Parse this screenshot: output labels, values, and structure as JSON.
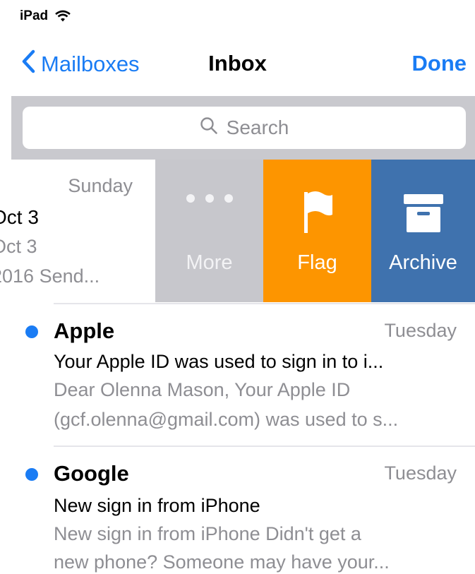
{
  "status_bar": {
    "device": "iPad"
  },
  "nav": {
    "back_label": "Mailboxes",
    "title": "Inbox",
    "done_label": "Done"
  },
  "search": {
    "placeholder": "Search"
  },
  "swiped_message": {
    "date": "Sunday",
    "sender": "Oct 3",
    "line1": "Oct 3",
    "line2": "2016 Send..."
  },
  "swipe_actions": {
    "more": "More",
    "flag": "Flag",
    "archive": "Archive"
  },
  "messages": [
    {
      "sender": "Apple",
      "date": "Tuesday",
      "subject": "Your Apple ID was used to sign in to i...",
      "preview_line1": "Dear Olenna Mason, Your Apple ID",
      "preview_line2": "(gcf.olenna@gmail.com) was used to s..."
    },
    {
      "sender": "Google",
      "date": "Tuesday",
      "subject": "New sign in from iPhone",
      "preview_line1": "New sign in from iPhone Didn't get a",
      "preview_line2": "new phone? Someone may have your..."
    }
  ],
  "colors": {
    "accent": "#1a7cf4",
    "more_action": "#c7c7cc",
    "flag_action": "#fd9500",
    "archive_action": "#3f72ae",
    "secondary_text": "#8e8e93"
  },
  "icons": {
    "wifi": "wifi-icon",
    "back": "chevron-left-icon",
    "search": "search-icon",
    "more": "ellipsis-icon",
    "flag": "flag-icon",
    "archive": "archive-box-icon"
  }
}
